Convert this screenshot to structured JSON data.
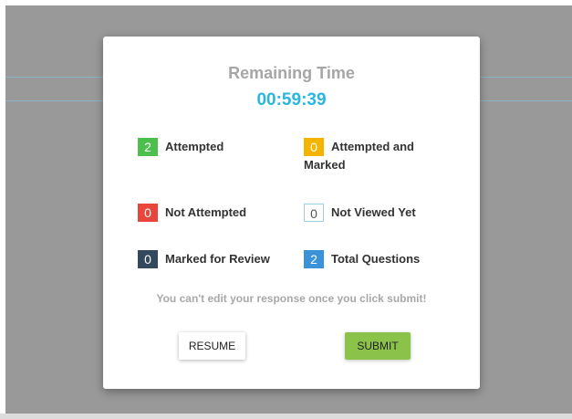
{
  "modal": {
    "title": "Remaining Time",
    "timer": "00:59:39",
    "stats": {
      "attempted": {
        "count": "2",
        "label": "Attempted",
        "color": "#4cbf4c"
      },
      "attempted_and_marked": {
        "count": "0",
        "label": "Attempted and Marked",
        "color": "#f5b400"
      },
      "not_attempted": {
        "count": "0",
        "label": "Not Attempted",
        "color": "#e8463c"
      },
      "not_viewed_yet": {
        "count": "0",
        "label": "Not Viewed Yet",
        "color": "#ffffff"
      },
      "marked_for_review": {
        "count": "0",
        "label": "Marked for Review",
        "color": "#34495e"
      },
      "total_questions": {
        "count": "2",
        "label": "Total Questions",
        "color": "#3a93d8"
      }
    },
    "warning": "You can't edit your response once you click submit!",
    "resume_label": "RESUME",
    "submit_label": "SUBMIT"
  },
  "colors": {
    "timer": "#29b6e0",
    "submit_button": "#8bc34a",
    "overlay": "#999999"
  }
}
